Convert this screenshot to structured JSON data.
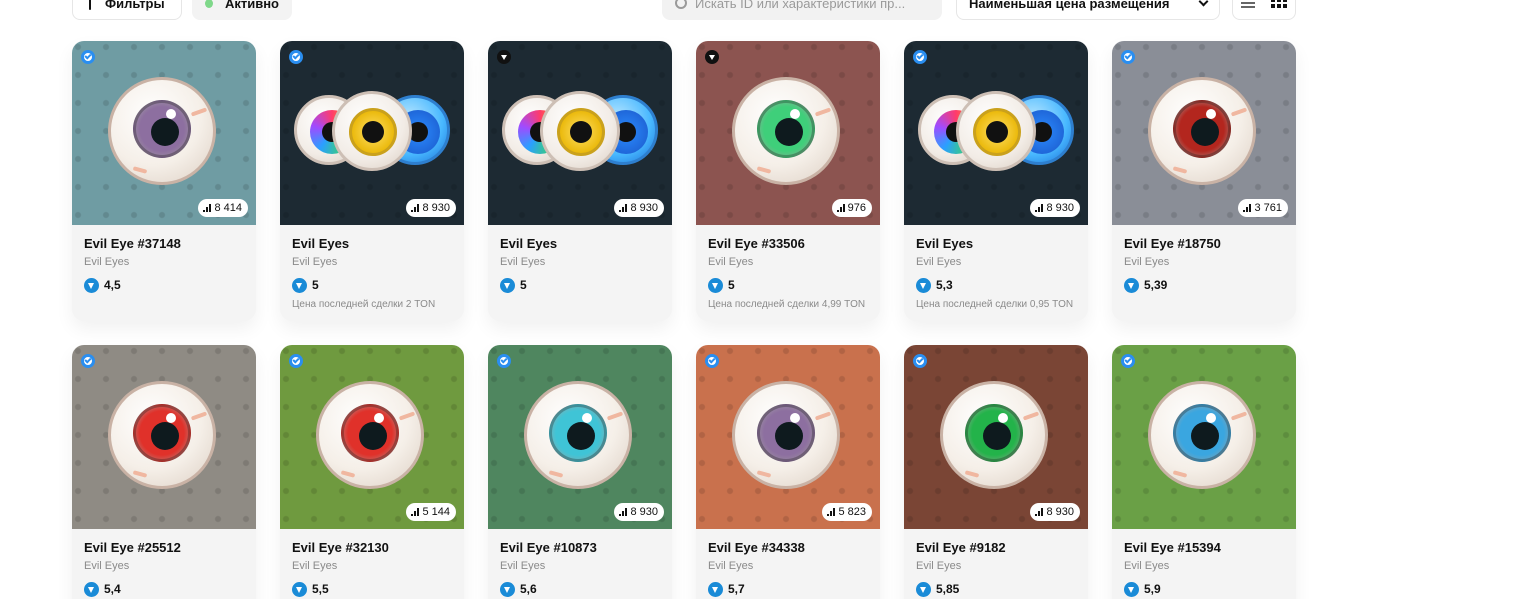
{
  "toolbar": {
    "filters_label": "Фильтры",
    "active_label": "Активно",
    "search_placeholder": "Искать ID или характеристики пр...",
    "sort_label": "Наименьшая цена размещения"
  },
  "colors": {
    "ton_blue": "#1a8bd7",
    "verified_blue": "#2a8ef0",
    "active_dot": "#7fd88a"
  },
  "cards": [
    {
      "name": "Evil Eye #37148",
      "collection": "Evil Eyes",
      "price": "4,5",
      "stat": "8 414",
      "last_sale": "",
      "badge": "verified-check-icon",
      "bg": "#6f9ca3",
      "art": "single",
      "iris": "#8d6fa0"
    },
    {
      "name": "Evil Eyes",
      "collection": "Evil Eyes",
      "price": "5",
      "stat": "8 930",
      "last_sale": "Цена последней сделки 2 TON",
      "badge": "verified-check-icon",
      "bg": "#1d2a33",
      "art": "trio",
      "iris": ""
    },
    {
      "name": "Evil Eyes",
      "collection": "Evil Eyes",
      "price": "5",
      "stat": "8 930",
      "last_sale": "",
      "badge": "marketplace-triangle-icon",
      "bg": "#1d2a33",
      "art": "trio",
      "iris": ""
    },
    {
      "name": "Evil Eye #33506",
      "collection": "Evil Eyes",
      "price": "5",
      "stat": "976",
      "last_sale": "Цена последней сделки 4,99 TON",
      "badge": "marketplace-triangle-icon",
      "bg": "#8c5450",
      "art": "single",
      "iris": "#3fcf7a"
    },
    {
      "name": "Evil Eyes",
      "collection": "Evil Eyes",
      "price": "5,3",
      "stat": "8 930",
      "last_sale": "Цена последней сделки 0,95 TON",
      "badge": "verified-check-icon",
      "bg": "#1d2a33",
      "art": "trio",
      "iris": ""
    },
    {
      "name": "Evil Eye #18750",
      "collection": "Evil Eyes",
      "price": "5,39",
      "stat": "3 761",
      "last_sale": "",
      "badge": "verified-check-icon",
      "bg": "#8a8e97",
      "art": "single",
      "iris": "#b3261e"
    },
    {
      "name": "Evil Eye #25512",
      "collection": "Evil Eyes",
      "price": "5,4",
      "stat": "",
      "last_sale": "",
      "badge": "verified-check-icon",
      "bg": "#8f8b84",
      "art": "single",
      "iris": "#e0312a"
    },
    {
      "name": "Evil Eye #32130",
      "collection": "Evil Eyes",
      "price": "5,5",
      "stat": "5 144",
      "last_sale": "",
      "badge": "verified-check-icon",
      "bg": "#6f9a3f",
      "art": "single",
      "iris": "#e0312a"
    },
    {
      "name": "Evil Eye #10873",
      "collection": "Evil Eyes",
      "price": "5,6",
      "stat": "8 930",
      "last_sale": "",
      "badge": "verified-check-icon",
      "bg": "#4f865f",
      "art": "single",
      "iris": "#3fc4d6"
    },
    {
      "name": "Evil Eye #34338",
      "collection": "Evil Eyes",
      "price": "5,7",
      "stat": "5 823",
      "last_sale": "",
      "badge": "verified-check-icon",
      "bg": "#c9714d",
      "art": "single",
      "iris": "#8d6fa0"
    },
    {
      "name": "Evil Eye #9182",
      "collection": "Evil Eyes",
      "price": "5,85",
      "stat": "8 930",
      "last_sale": "",
      "badge": "verified-check-icon",
      "bg": "#7a4535",
      "art": "single",
      "iris": "#23b34a"
    },
    {
      "name": "Evil Eye #15394",
      "collection": "Evil Eyes",
      "price": "5,9",
      "stat": "",
      "last_sale": "",
      "badge": "verified-check-icon",
      "bg": "#6aa046",
      "art": "single",
      "iris": "#3aa6e0"
    }
  ]
}
